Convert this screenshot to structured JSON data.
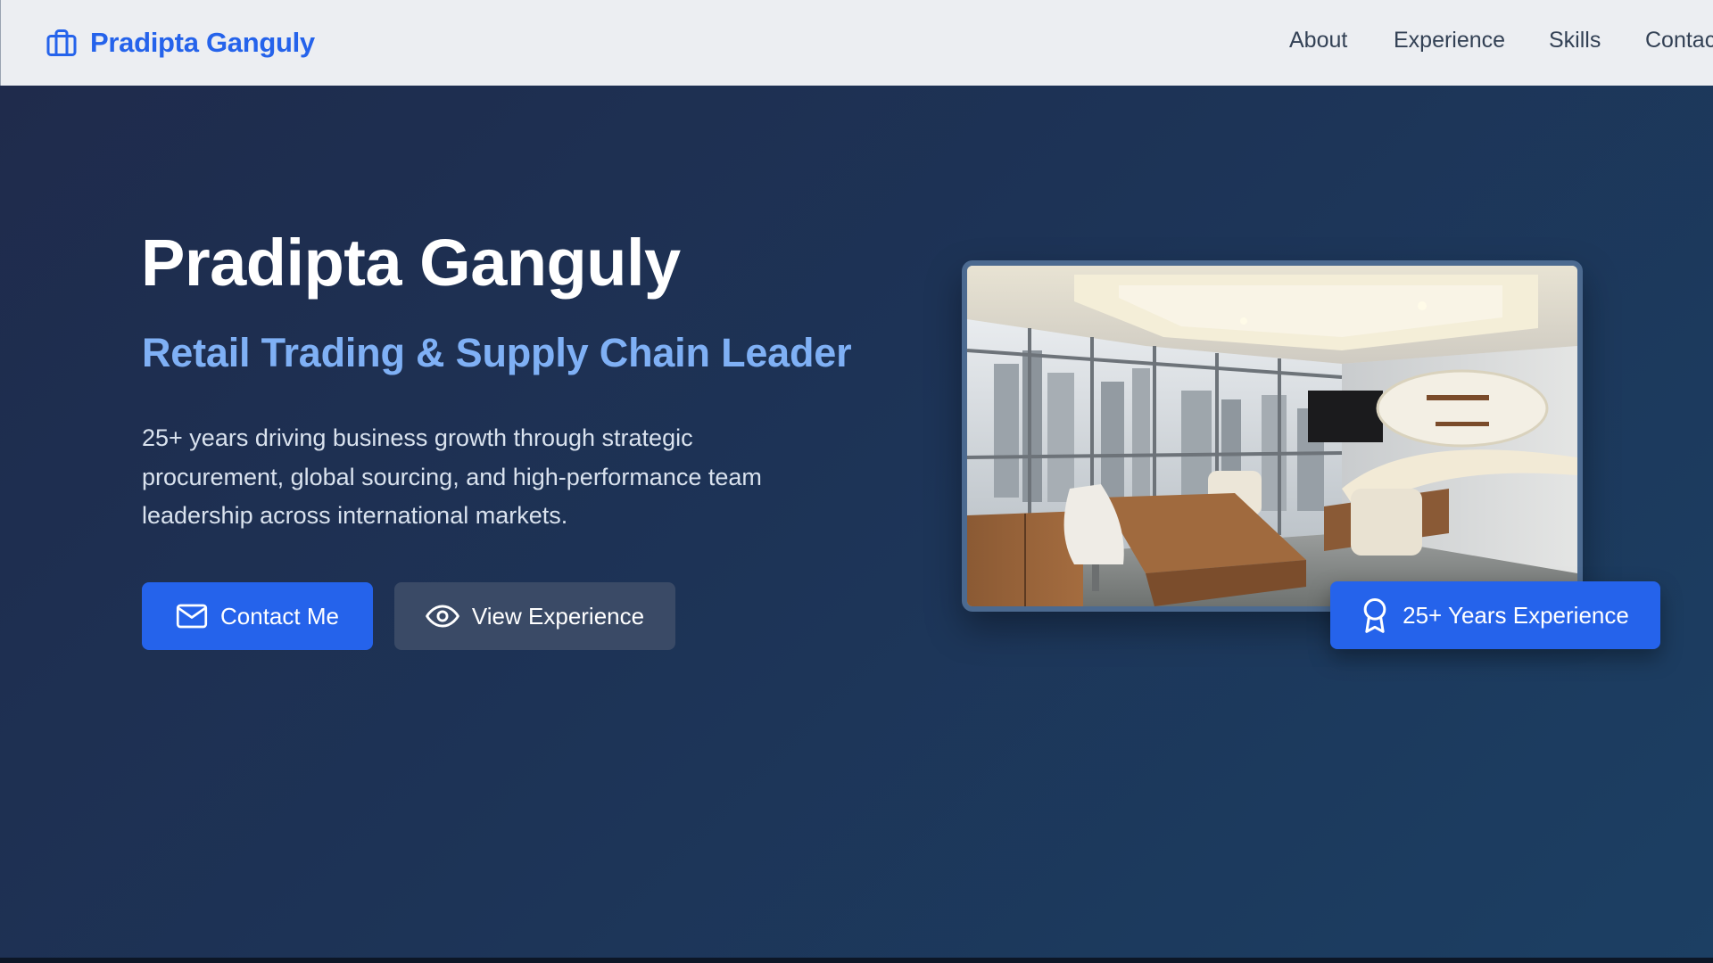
{
  "brand": {
    "name": "Pradipta Ganguly",
    "icon": "briefcase-icon",
    "color": "#2563eb"
  },
  "nav": {
    "links": [
      "About",
      "Experience",
      "Skills",
      "Contac"
    ]
  },
  "hero": {
    "title": "Pradipta Ganguly",
    "subtitle": "Retail Trading & Supply Chain Leader",
    "description": "25+ years driving business growth through strategic procurement, global sourcing, and high-performance team leadership across international markets.",
    "buttons": {
      "contact_label": "Contact Me",
      "contact_icon": "mail-icon",
      "experience_label": "View Experience",
      "experience_icon": "eye-icon"
    },
    "photo": {
      "subject": "office-interior-photo"
    },
    "badge": {
      "label": "25+ Years Experience",
      "icon": "award-icon"
    }
  },
  "colors": {
    "primary": "#2563eb",
    "subtitle": "#7fb0f5",
    "hero_bg_start": "#1f2b4c",
    "hero_bg_end": "#1c3f63",
    "navbar_bg": "#eceef2",
    "nav_text": "#334155"
  }
}
